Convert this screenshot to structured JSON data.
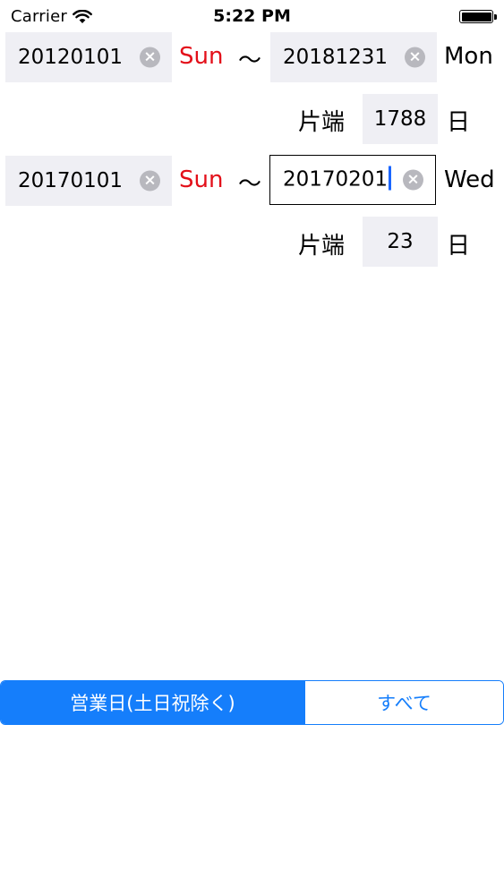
{
  "status_bar": {
    "carrier": "Carrier",
    "time": "5:22 PM"
  },
  "range1": {
    "start_value": "20120101",
    "start_day": "Sun",
    "separator": "〜",
    "end_value": "20181231",
    "end_day": "Mon",
    "count_label": "片端",
    "count_value": "1788",
    "unit": "日"
  },
  "range2": {
    "start_value": "20170101",
    "start_day": "Sun",
    "separator": "〜",
    "end_value": "20170201",
    "end_day": "Wed",
    "count_label": "片端",
    "count_value": "23",
    "unit": "日"
  },
  "segmented": {
    "business_days": "営業日(土日祝除く)",
    "all": "すべて",
    "selected": "business_days"
  },
  "colors": {
    "accent": "#157efb",
    "weekend_red": "#e3101a",
    "field_bg": "#efeff4"
  }
}
